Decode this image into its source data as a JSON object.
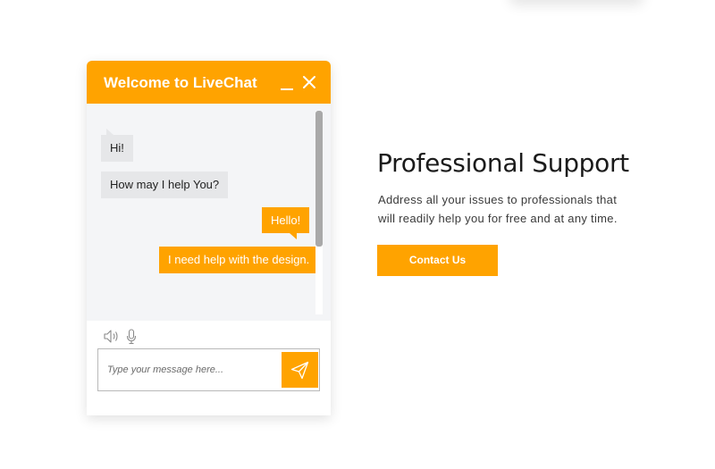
{
  "colors": {
    "accent": "#ffa300",
    "chat_bg": "#f4f5f7",
    "incoming_bubble": "#e6e7e9"
  },
  "chat": {
    "title": "Welcome to LiveChat",
    "header_icons": [
      "minimize-icon",
      "close-icon"
    ],
    "messages": [
      {
        "direction": "incoming",
        "text": "Hi!"
      },
      {
        "direction": "incoming",
        "text": "How may I help You?"
      },
      {
        "direction": "outgoing",
        "text": "Hello!"
      },
      {
        "direction": "outgoing",
        "text": "I need help with the design."
      }
    ],
    "footer_icons": [
      "speaker-icon",
      "microphone-icon"
    ],
    "input": {
      "value": "",
      "placeholder": "Type your message here..."
    },
    "send_icon": "paper-plane-icon"
  },
  "promo": {
    "heading": "Professional Support",
    "description_lines": [
      "Address all your issues to professionals that",
      "will readily help you for free and at any time."
    ],
    "cta_label": "Contact Us"
  }
}
